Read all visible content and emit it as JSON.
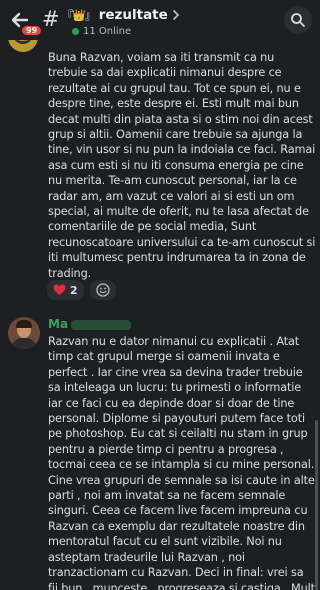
{
  "header": {
    "unread_count": "99",
    "channel_symbol": "#",
    "title_prefix": "『👑』",
    "title": "rezultate",
    "online_count": "11 Online"
  },
  "messages": [
    {
      "text": "Buna Razvan, voiam sa iti transmit ca nu trebuie sa dai explicatii nimanui despre ce rezultate ai cu grupul tau. Tot ce spun ei, nu e despre tine, este despre ei. Esti mult mai bun decat multi din piata asta si o stim noi din acest grup si altii. Oamenii care trebuie sa ajunga la tine, vin usor si nu pun la indoiala ce faci. Ramai asa cum esti si nu iti consuma energia pe cine nu merita. Te-am cunoscut personal, iar la ce radar am, am vazut ce valori ai si esti un om special, ai multe de oferit, nu te lasa afectat de comentariile de pe social media, Sunt recunoscatoare universului ca te-am cunoscut si iti multumesc pentru indrumarea ta in zona de trading.",
      "reactions": [
        {
          "emoji": "❤️",
          "count": "2",
          "icon": "heart-icon"
        }
      ]
    },
    {
      "author": "Ma",
      "text": "Razvan nu e dator nimanui cu explicatii . Atat timp cat grupul merge si oamenii invata e perfect . Iar cine vrea sa devina trader trebuie sa inteleaga un lucru: tu primesti o informatie iar ce faci cu ea depinde doar si doar de tine personal. Diplome si payouturi putem face toti pe photoshop. Eu cat si ceilalti nu stam in grup pentru a pierde timp ci pentru a progresa , tocmai ceea ce se intampla si cu mine personal. Cine vrea grupuri de semnale sa isi caute in alte parti , noi am invatat sa ne facem semnale singuri. Ceea ce facem live facem impreuna cu Razvan ca exemplu dar rezultatele noastre din mentoratul facut cu el sunt vizibile. Noi nu asteptam tradeurile lui Razvan , noi tranzactionam cu Razvan. Deci in final: vrei sa fii bun , munceste , progreseaza si castiga . Mult"
    }
  ]
}
